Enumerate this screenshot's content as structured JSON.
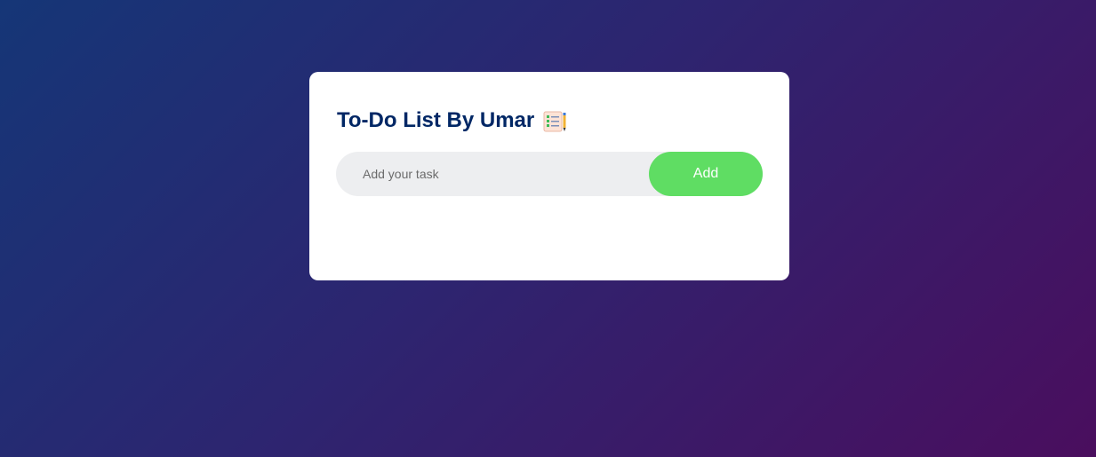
{
  "todo": {
    "title": "To-Do List By Umar",
    "icon": "checklist-notepad-icon",
    "input": {
      "placeholder": "Add your task",
      "value": ""
    },
    "add_label": "Add"
  },
  "colors": {
    "title": "#002765",
    "add_button": "#5fdd63",
    "input_background": "#edeef0",
    "gradient_start": "#153677",
    "gradient_end": "#4a0e5e"
  }
}
